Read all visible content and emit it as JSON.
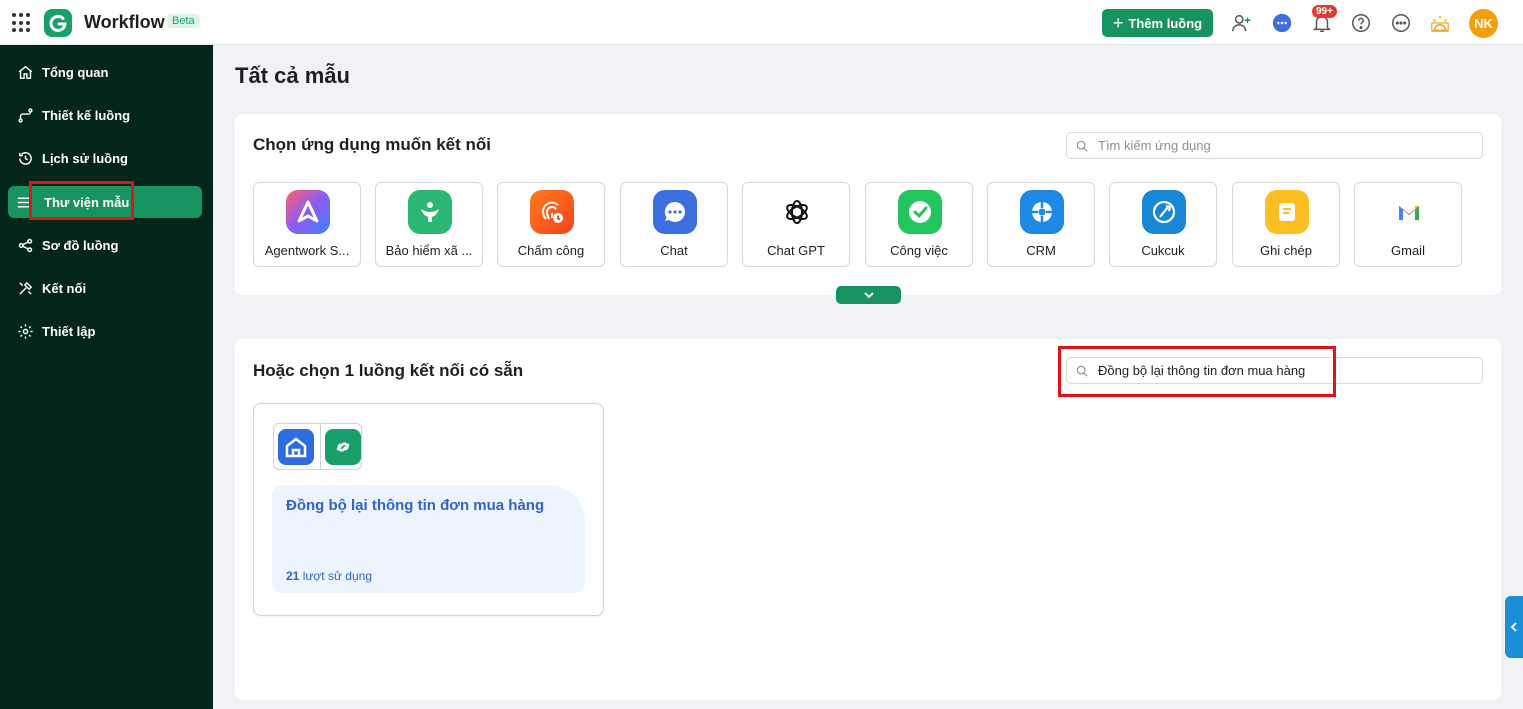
{
  "header": {
    "app_title": "Workflow",
    "beta_label": "Beta",
    "add_flow_label": "Thêm luồng",
    "notification_count": "99+",
    "avatar_initials": "NK"
  },
  "sidebar": {
    "items": [
      {
        "label": "Tổng quan",
        "icon": "home-icon"
      },
      {
        "label": "Thiết kế luồng",
        "icon": "flow-design-icon"
      },
      {
        "label": "Lịch sử luồng",
        "icon": "history-icon"
      },
      {
        "label": "Thư viện mẫu",
        "icon": "menu-icon",
        "active": true
      },
      {
        "label": "Sơ đồ luồng",
        "icon": "share-nodes-icon"
      },
      {
        "label": "Kết nối",
        "icon": "tools-icon"
      },
      {
        "label": "Thiết lập",
        "icon": "gear-icon"
      }
    ]
  },
  "main": {
    "page_title": "Tất cả mẫu",
    "apps_section": {
      "title": "Chọn ứng dụng muốn kết nối",
      "search_placeholder": "Tìm kiếm ứng dụng",
      "apps": [
        {
          "label": "Agentwork S...",
          "icon": "agentwork-icon"
        },
        {
          "label": "Bảo hiểm xã ...",
          "icon": "insurance-icon"
        },
        {
          "label": "Chấm công",
          "icon": "timekeeping-icon"
        },
        {
          "label": "Chat",
          "icon": "chat-icon"
        },
        {
          "label": "Chat GPT",
          "icon": "chatgpt-icon"
        },
        {
          "label": "Công việc",
          "icon": "task-icon"
        },
        {
          "label": "CRM",
          "icon": "crm-icon"
        },
        {
          "label": "Cukcuk",
          "icon": "cukcuk-icon"
        },
        {
          "label": "Ghi chép",
          "icon": "notes-icon"
        },
        {
          "label": "Gmail",
          "icon": "gmail-icon"
        }
      ]
    },
    "flows_section": {
      "title": "Hoặc chọn 1 luồng kết nối có sẵn",
      "search_value": "Đồng bộ lại thông tin đơn mua hàng",
      "flows": [
        {
          "name": "Đồng bộ lại thông tin đơn mua hàng",
          "usage_count": "21",
          "usage_label": "lượt sử dụng"
        }
      ]
    }
  },
  "colors": {
    "brand_green": "#17935f",
    "sidebar_bg": "#03251a",
    "highlight_red": "#e01414",
    "flow_text_blue": "#2f64c8"
  }
}
